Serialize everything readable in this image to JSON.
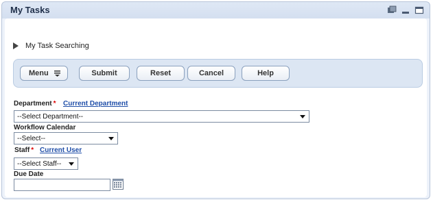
{
  "window": {
    "title": "My Tasks",
    "icons": [
      "refresh-icon",
      "minimize-icon",
      "maximize-icon"
    ]
  },
  "section": {
    "title": "My Task Searching"
  },
  "toolbar": {
    "menu_label": "Menu",
    "submit_label": "Submit",
    "reset_label": "Reset",
    "cancel_label": "Cancel",
    "help_label": "Help"
  },
  "form": {
    "department": {
      "label": "Department",
      "required_mark": "*",
      "link": "Current Department",
      "value": "--Select Department--"
    },
    "workflow_calendar": {
      "label": "Workflow Calendar",
      "value": "--Select--"
    },
    "staff": {
      "label": "Staff",
      "required_mark": "*",
      "link": "Current User",
      "value": "--Select Staff--"
    },
    "due_date": {
      "label": "Due Date",
      "value": ""
    }
  },
  "colors": {
    "accent": "#1f4ea8",
    "required": "#dd0000",
    "toolbar_bg": "#dce6f3"
  }
}
